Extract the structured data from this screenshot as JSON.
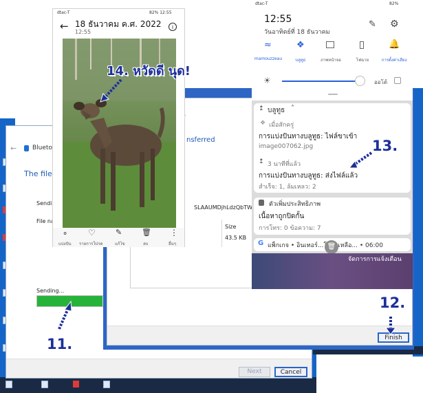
{
  "wizard": {
    "title": "Bluetooth File Transfer",
    "heading": "The file is",
    "sending_label": "Sending",
    "file_label": "File nar",
    "sending_progress_text": "Sending...",
    "progress": 0.82,
    "buttons": {
      "next": "Next",
      "cancel": "Cancel"
    }
  },
  "done_dialog": {
    "partial_top": "r",
    "heading": "nsferred",
    "file_name": "SLAAUMDjhLdzQbTWF0",
    "size_header": "Size",
    "size_value": "43.5 KB",
    "finish": "Finish"
  },
  "phone_gallery": {
    "status_left": "dtac-T",
    "status_right": "82% 12:55",
    "date": "18 ธันวาคม ค.ศ. 2022",
    "time": "12:55",
    "toolbar": [
      "แบ่งปัน",
      "รายการโปรด",
      "แก้ไข",
      "ลบ",
      "อื่นๆ"
    ]
  },
  "phone_panel": {
    "status_left": "dtac-T",
    "status_right": "82%",
    "time": "12:55",
    "date": "วันอาทิตย์ที่ 18 ธันวาคม",
    "quick": [
      "mamouzzeau",
      "บลูทูธ",
      "ภาพหน้าจอ",
      "ไฟฉาย",
      "การตั้งค่าเสียง"
    ],
    "auto_label": "ออโต้",
    "bt_group": "บลูทูธ",
    "n1_meta": "เมื่อสักครู่",
    "n1_title": "การแบ่งปันทางบลูทูธ: ไฟล์ขาเข้า",
    "n1_sub": "image007062.jpg",
    "n2_meta": "3 นาทีที่แล้ว",
    "n2_title": "การแบ่งปันทางบลูทูธ: ส่งไฟล์แล้ว",
    "n2_sub": "สำเร็จ: 1, ล้มเหลว: 2",
    "optimizer_title": "ตัวเพิ่มประสิทธิภาพ",
    "optimizer_sub": "เนื้อหาถูกปิดกั้น",
    "optimizer_detail": "การโทร: 0 ข้อความ: 7",
    "google_row": "แพ็กเกจ • อินเทอร์...โดคงเหลือ... • 06:00",
    "manage": "จัดการการแจ้งเตือน"
  },
  "annotations": {
    "n11": "11.",
    "n12": "12.",
    "n13": "13.",
    "n14": "14. หวัดดี นุด!"
  }
}
